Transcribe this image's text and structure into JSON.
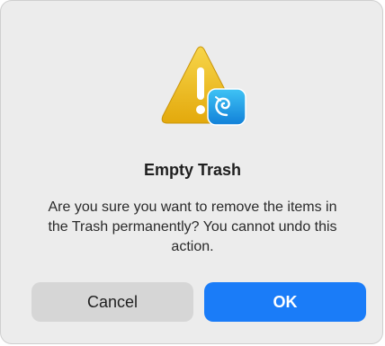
{
  "dialog": {
    "title": "Empty Trash",
    "message": "Are you sure you want to remove the items in the Trash permanently? You cannot undo this action.",
    "icon": "warning-icon",
    "badge_icon": "finder-app-icon",
    "cancel_label": "Cancel",
    "ok_label": "OK"
  },
  "colors": {
    "dialog_background": "#ececec",
    "ok_button": "#1a7cf8",
    "cancel_button": "#d6d6d6",
    "warning_yellow": "#f2c40f",
    "badge_blue": "#1b9ee6"
  }
}
